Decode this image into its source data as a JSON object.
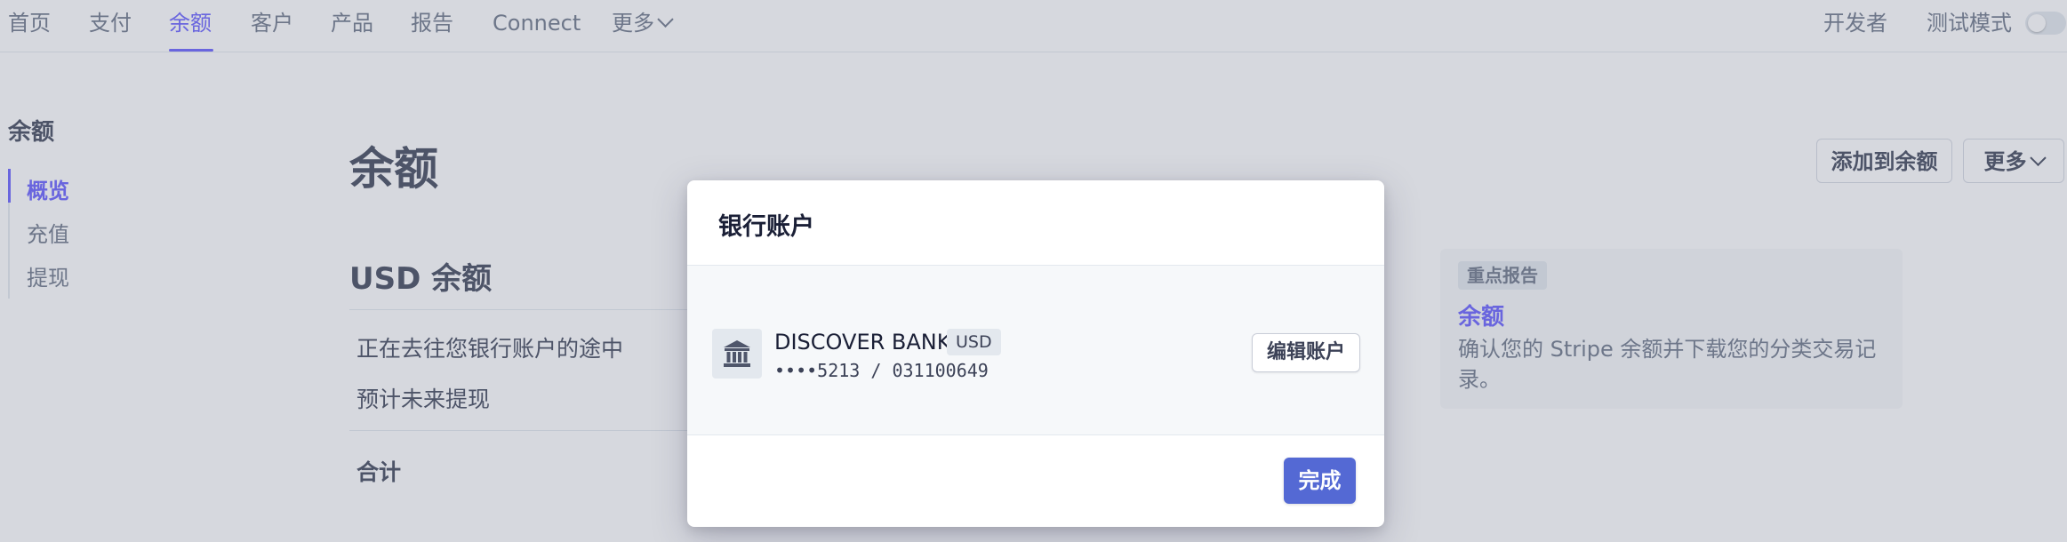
{
  "topnav": {
    "items": [
      {
        "label": "首页"
      },
      {
        "label": "支付"
      },
      {
        "label": "余额",
        "active": true
      },
      {
        "label": "客户"
      },
      {
        "label": "产品"
      },
      {
        "label": "报告"
      },
      {
        "label": "Connect"
      },
      {
        "label": "更多"
      }
    ],
    "developers": "开发者",
    "test_mode": "测试模式",
    "test_mode_enabled": false
  },
  "sidebar": {
    "title": "余额",
    "items": [
      {
        "label": "概览",
        "active": true
      },
      {
        "label": "充值"
      },
      {
        "label": "提现"
      }
    ]
  },
  "main": {
    "title": "余额",
    "add_button": "添加到余额",
    "more_button": "更多",
    "usd_title": "USD 余额",
    "rows": [
      "正在去往您银行账户的途中",
      "预计未来提现"
    ],
    "total_label": "合计"
  },
  "report": {
    "badge": "重点报告",
    "link": "余额",
    "description": "确认您的 Stripe 余额并下载您的分类交易记录。"
  },
  "modal": {
    "title": "银行账户",
    "bank_name": "DISCOVER BANK",
    "currency": "USD",
    "account": "••••5213 / 031100649",
    "edit_button": "编辑账户",
    "done_button": "完成"
  },
  "colors": {
    "accent": "#635bff",
    "primary_button": "#5469d4",
    "text": "#3c4257",
    "muted": "#697386"
  }
}
